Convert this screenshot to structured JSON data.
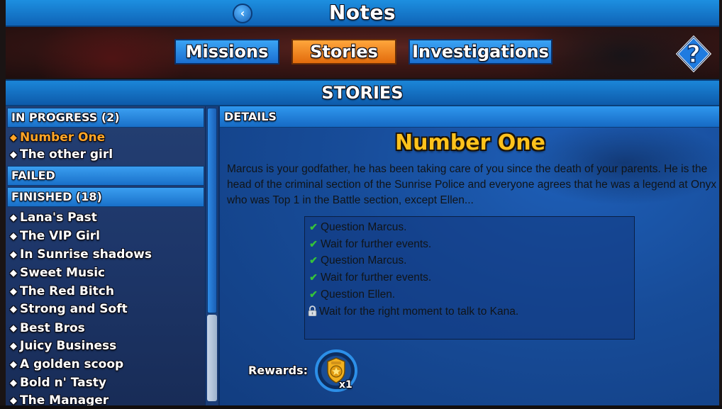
{
  "header": {
    "title": "Notes",
    "back_icon": "chevron-left-icon"
  },
  "tabs": [
    {
      "label": "Missions",
      "active": false
    },
    {
      "label": "Stories",
      "active": true
    },
    {
      "label": "Investigations",
      "active": false
    }
  ],
  "help_icon": "question-mark-icon",
  "section_title": "STORIES",
  "sidebar": {
    "in_progress_header": "IN PROGRESS (2)",
    "in_progress": [
      "Number One",
      "The other girl"
    ],
    "failed_header": "FAILED",
    "finished_header": "FINISHED (18)",
    "finished": [
      "Lana's Past",
      "The VIP Girl",
      "In Sunrise shadows",
      "Sweet Music",
      "The Red Bitch",
      "Strong and Soft",
      "Best Bros",
      "Juicy Business",
      "A golden scoop",
      "Bold n' Tasty",
      "The Manager"
    ],
    "selected": "Number One"
  },
  "details": {
    "header": "DETAILS",
    "title": "Number One",
    "description": "Marcus is your godfather, he has been taking care of you since the death of your parents. He is the head of the criminal section of the Sunrise Police and everyone agrees that he was a legend at Onyx who was Top 1 in the Battle section, except Ellen...",
    "tasks": [
      {
        "text": "Question Marcus.",
        "status": "done",
        "icon": "check-icon"
      },
      {
        "text": "Wait for further events.",
        "status": "done",
        "icon": "check-icon"
      },
      {
        "text": "Question Marcus.",
        "status": "done",
        "icon": "check-icon"
      },
      {
        "text": "Wait for further events.",
        "status": "done",
        "icon": "check-icon"
      },
      {
        "text": "Question Ellen.",
        "status": "done",
        "icon": "check-icon"
      },
      {
        "text": "Wait for the right moment to talk to Kana.",
        "status": "locked",
        "icon": "lock-icon"
      }
    ],
    "rewards_label": "Rewards:",
    "reward": {
      "icon": "police-badge-icon",
      "quantity": "x1"
    }
  },
  "colors": {
    "accent_orange": "#e8781a",
    "tab_blue": "#2b8ae6",
    "title_gold": "#ffc21c",
    "selected_item": "#ffa526",
    "check_green": "#35c33a"
  }
}
